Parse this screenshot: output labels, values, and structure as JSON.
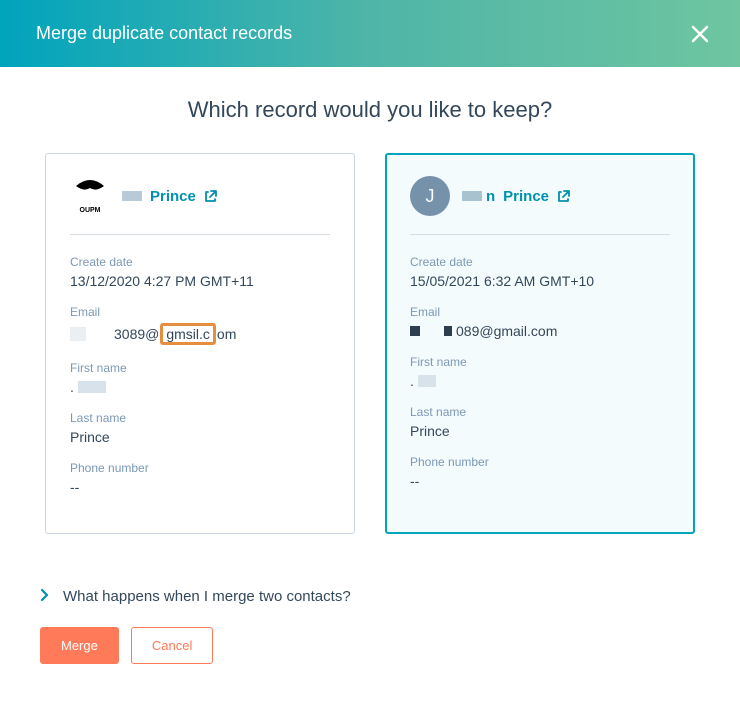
{
  "header": {
    "title": "Merge duplicate contact records"
  },
  "question": "Which record would you like to keep?",
  "cards": [
    {
      "avatar_letter": "",
      "name_suffix": "Prince",
      "fields": {
        "create_date_label": "Create date",
        "create_date": "13/12/2020 4:27 PM GMT+11",
        "email_label": "Email",
        "email_prefix": "3089@",
        "email_highlight": "gmsil.c",
        "email_suffix": "om",
        "first_name_label": "First name",
        "last_name_label": "Last name",
        "last_name": "Prince",
        "phone_label": "Phone number",
        "phone": "--"
      }
    },
    {
      "avatar_letter": "J",
      "name_suffix": "Prince",
      "name_prefix_char": "n",
      "fields": {
        "create_date_label": "Create date",
        "create_date": "15/05/2021 6:32 AM GMT+10",
        "email_label": "Email",
        "email_suffix": "089@gmail.com",
        "first_name_label": "First name",
        "last_name_label": "Last name",
        "last_name": "Prince",
        "phone_label": "Phone number",
        "phone": "--"
      }
    }
  ],
  "expander_text": "What happens when I merge two contacts?",
  "buttons": {
    "merge": "Merge",
    "cancel": "Cancel"
  }
}
